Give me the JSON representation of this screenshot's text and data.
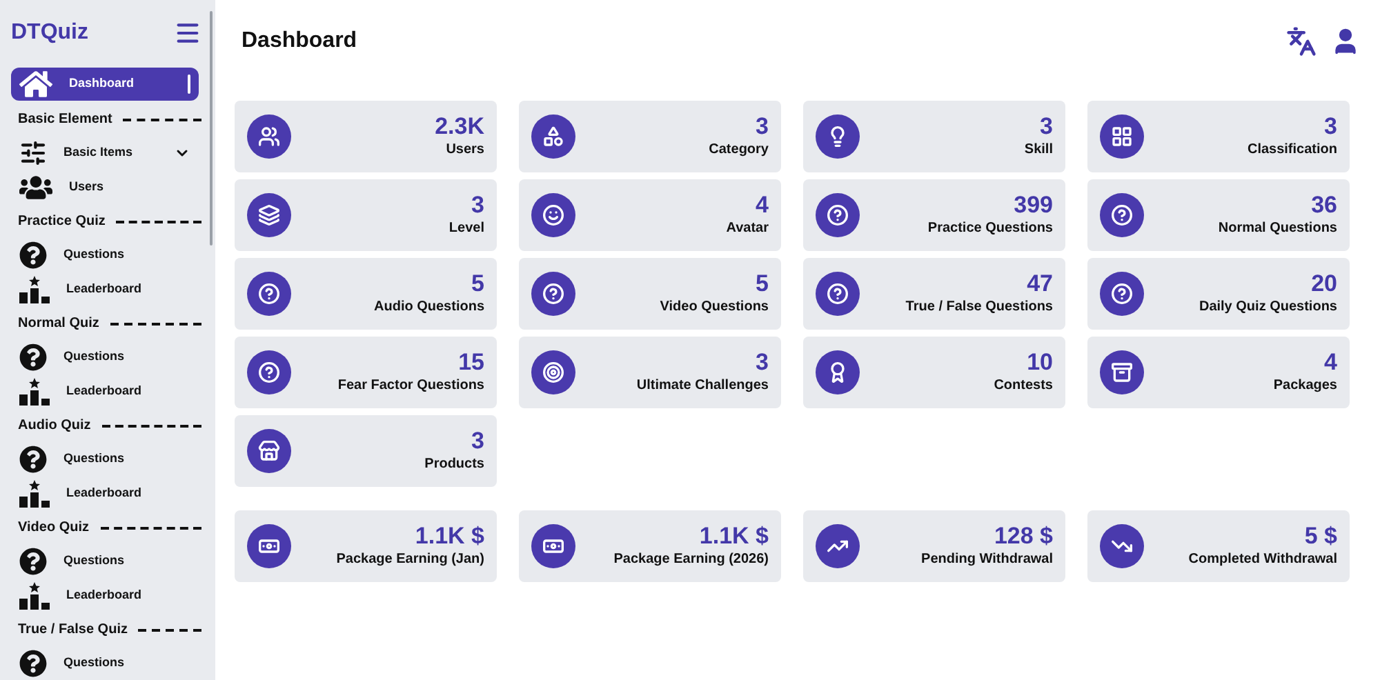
{
  "sidebar": {
    "brand": "DTQuiz",
    "items": [
      {
        "kind": "dashboard",
        "label": "Dashboard",
        "selected": true
      },
      {
        "kind": "section",
        "label": "Basic Element"
      },
      {
        "kind": "basic-items",
        "label": "Basic Items",
        "selected": false,
        "expandable": true
      },
      {
        "kind": "users",
        "label": "Users",
        "selected": false
      },
      {
        "kind": "section",
        "label": "Practice Quiz"
      },
      {
        "kind": "questions",
        "label": "Questions",
        "selected": false
      },
      {
        "kind": "leaderboard",
        "label": "Leaderboard",
        "selected": false
      },
      {
        "kind": "section",
        "label": "Normal Quiz"
      },
      {
        "kind": "questions",
        "label": "Questions",
        "selected": false
      },
      {
        "kind": "leaderboard",
        "label": "Leaderboard",
        "selected": false
      },
      {
        "kind": "section",
        "label": "Audio Quiz"
      },
      {
        "kind": "questions",
        "label": "Questions",
        "selected": false
      },
      {
        "kind": "leaderboard",
        "label": "Leaderboard",
        "selected": false
      },
      {
        "kind": "section",
        "label": "Video Quiz"
      },
      {
        "kind": "questions",
        "label": "Questions",
        "selected": false
      },
      {
        "kind": "leaderboard",
        "label": "Leaderboard",
        "selected": false
      },
      {
        "kind": "section",
        "label": "True / False Quiz"
      },
      {
        "kind": "questions",
        "label": "Questions",
        "selected": false
      }
    ]
  },
  "header": {
    "title": "Dashboard"
  },
  "stats": [
    {
      "kind": "users",
      "value": "2.3K",
      "label": "Users"
    },
    {
      "kind": "category",
      "value": "3",
      "label": "Category"
    },
    {
      "kind": "skill",
      "value": "3",
      "label": "Skill"
    },
    {
      "kind": "classification",
      "value": "3",
      "label": "Classification"
    },
    {
      "kind": "level",
      "value": "3",
      "label": "Level"
    },
    {
      "kind": "avatar",
      "value": "4",
      "label": "Avatar"
    },
    {
      "kind": "questions",
      "value": "399",
      "label": "Practice Questions"
    },
    {
      "kind": "questions",
      "value": "36",
      "label": "Normal Questions"
    },
    {
      "kind": "questions",
      "value": "5",
      "label": "Audio Questions"
    },
    {
      "kind": "questions",
      "value": "5",
      "label": "Video Questions"
    },
    {
      "kind": "questions",
      "value": "47",
      "label": "True / False Questions"
    },
    {
      "kind": "questions",
      "value": "20",
      "label": "Daily Quiz Questions"
    },
    {
      "kind": "questions",
      "value": "15",
      "label": "Fear Factor Questions"
    },
    {
      "kind": "challenge",
      "value": "3",
      "label": "Ultimate Challenges"
    },
    {
      "kind": "contest",
      "value": "10",
      "label": "Contests"
    },
    {
      "kind": "package",
      "value": "4",
      "label": "Packages"
    },
    {
      "kind": "product",
      "value": "3",
      "label": "Products"
    }
  ],
  "earnings": [
    {
      "kind": "earning",
      "value": "1.1K $",
      "label": "Package Earning (Jan)"
    },
    {
      "kind": "earning",
      "value": "1.1K $",
      "label": "Package Earning (2026)"
    },
    {
      "kind": "pending",
      "value": "128 $",
      "label": "Pending Withdrawal"
    },
    {
      "kind": "completed",
      "value": "5 $",
      "label": "Completed Withdrawal"
    }
  ]
}
